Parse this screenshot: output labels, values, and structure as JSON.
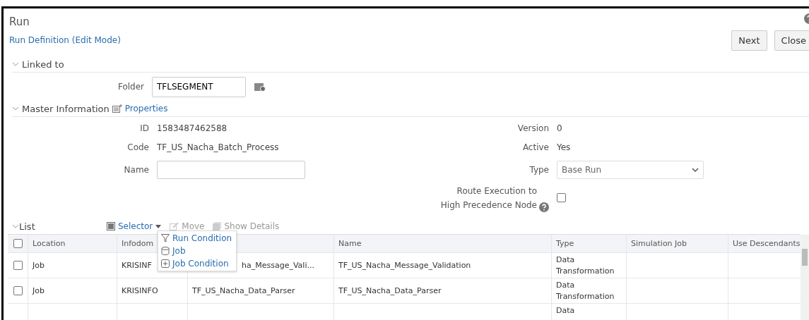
{
  "window": {
    "title": "Run"
  },
  "breadcrumb": "Run Definition (Edit Mode)",
  "buttons": [
    "Next",
    "Close"
  ],
  "linked_to": {
    "heading": "Linked to",
    "expanded": true,
    "folder_label": "Folder",
    "folder_value": "TFLSEGMENT"
  },
  "master_information": {
    "heading": "Master Information",
    "expanded": true,
    "properties_link": "Properties",
    "left": [
      {
        "label": "ID",
        "value": "1583487462588",
        "kind": "text"
      },
      {
        "label": "Code",
        "value": "TF_US_Nacha_Batch_Process",
        "kind": "text"
      },
      {
        "label": "Name",
        "kind": "input"
      }
    ],
    "right": [
      {
        "label": "Version",
        "value": "0",
        "kind": "text"
      },
      {
        "label": "Active",
        "value": "Yes",
        "kind": "text"
      },
      {
        "label": "Type",
        "value": "Base Run",
        "kind": "select"
      },
      {
        "label": "Route Execution to High Precedence Node",
        "kind": "checkbox",
        "checked": false
      }
    ]
  },
  "list": {
    "heading": "List",
    "expanded": true,
    "toolbar": [
      {
        "label": "Selector",
        "disabled": false,
        "kind": "selector"
      },
      {
        "label": "Move",
        "disabled": true,
        "kind": "move"
      },
      {
        "label": "Show Details",
        "disabled": true,
        "kind": "details"
      }
    ],
    "menu": [
      {
        "label": "Run Condition",
        "kind": "filter"
      },
      {
        "label": "Job",
        "kind": "job"
      },
      {
        "label": "Job Condition",
        "kind": "condition"
      }
    ],
    "table": {
      "columns": [
        "Location",
        "Infodom",
        "",
        "Name",
        "Type",
        "Simulation Job",
        "Use Descendants"
      ],
      "rows": [
        {
          "checked": false,
          "covered": true,
          "cells": [
            "Job",
            "KRISINF",
            "ha_Message_Vali...",
            "TF_US_Nacha_Message_Validation",
            "Data Transformation",
            "",
            ""
          ]
        },
        {
          "checked": false,
          "covered": false,
          "cells": [
            "Job",
            "KRISINFO",
            "TF_US_Nacha_Data_Parser",
            "TF_US_Nacha_Data_Parser",
            "Data Transformation",
            "",
            ""
          ]
        },
        {
          "cells": [
            "",
            "",
            "",
            "",
            "Data",
            "",
            ""
          ]
        }
      ],
      "select_all_checked": false
    }
  }
}
